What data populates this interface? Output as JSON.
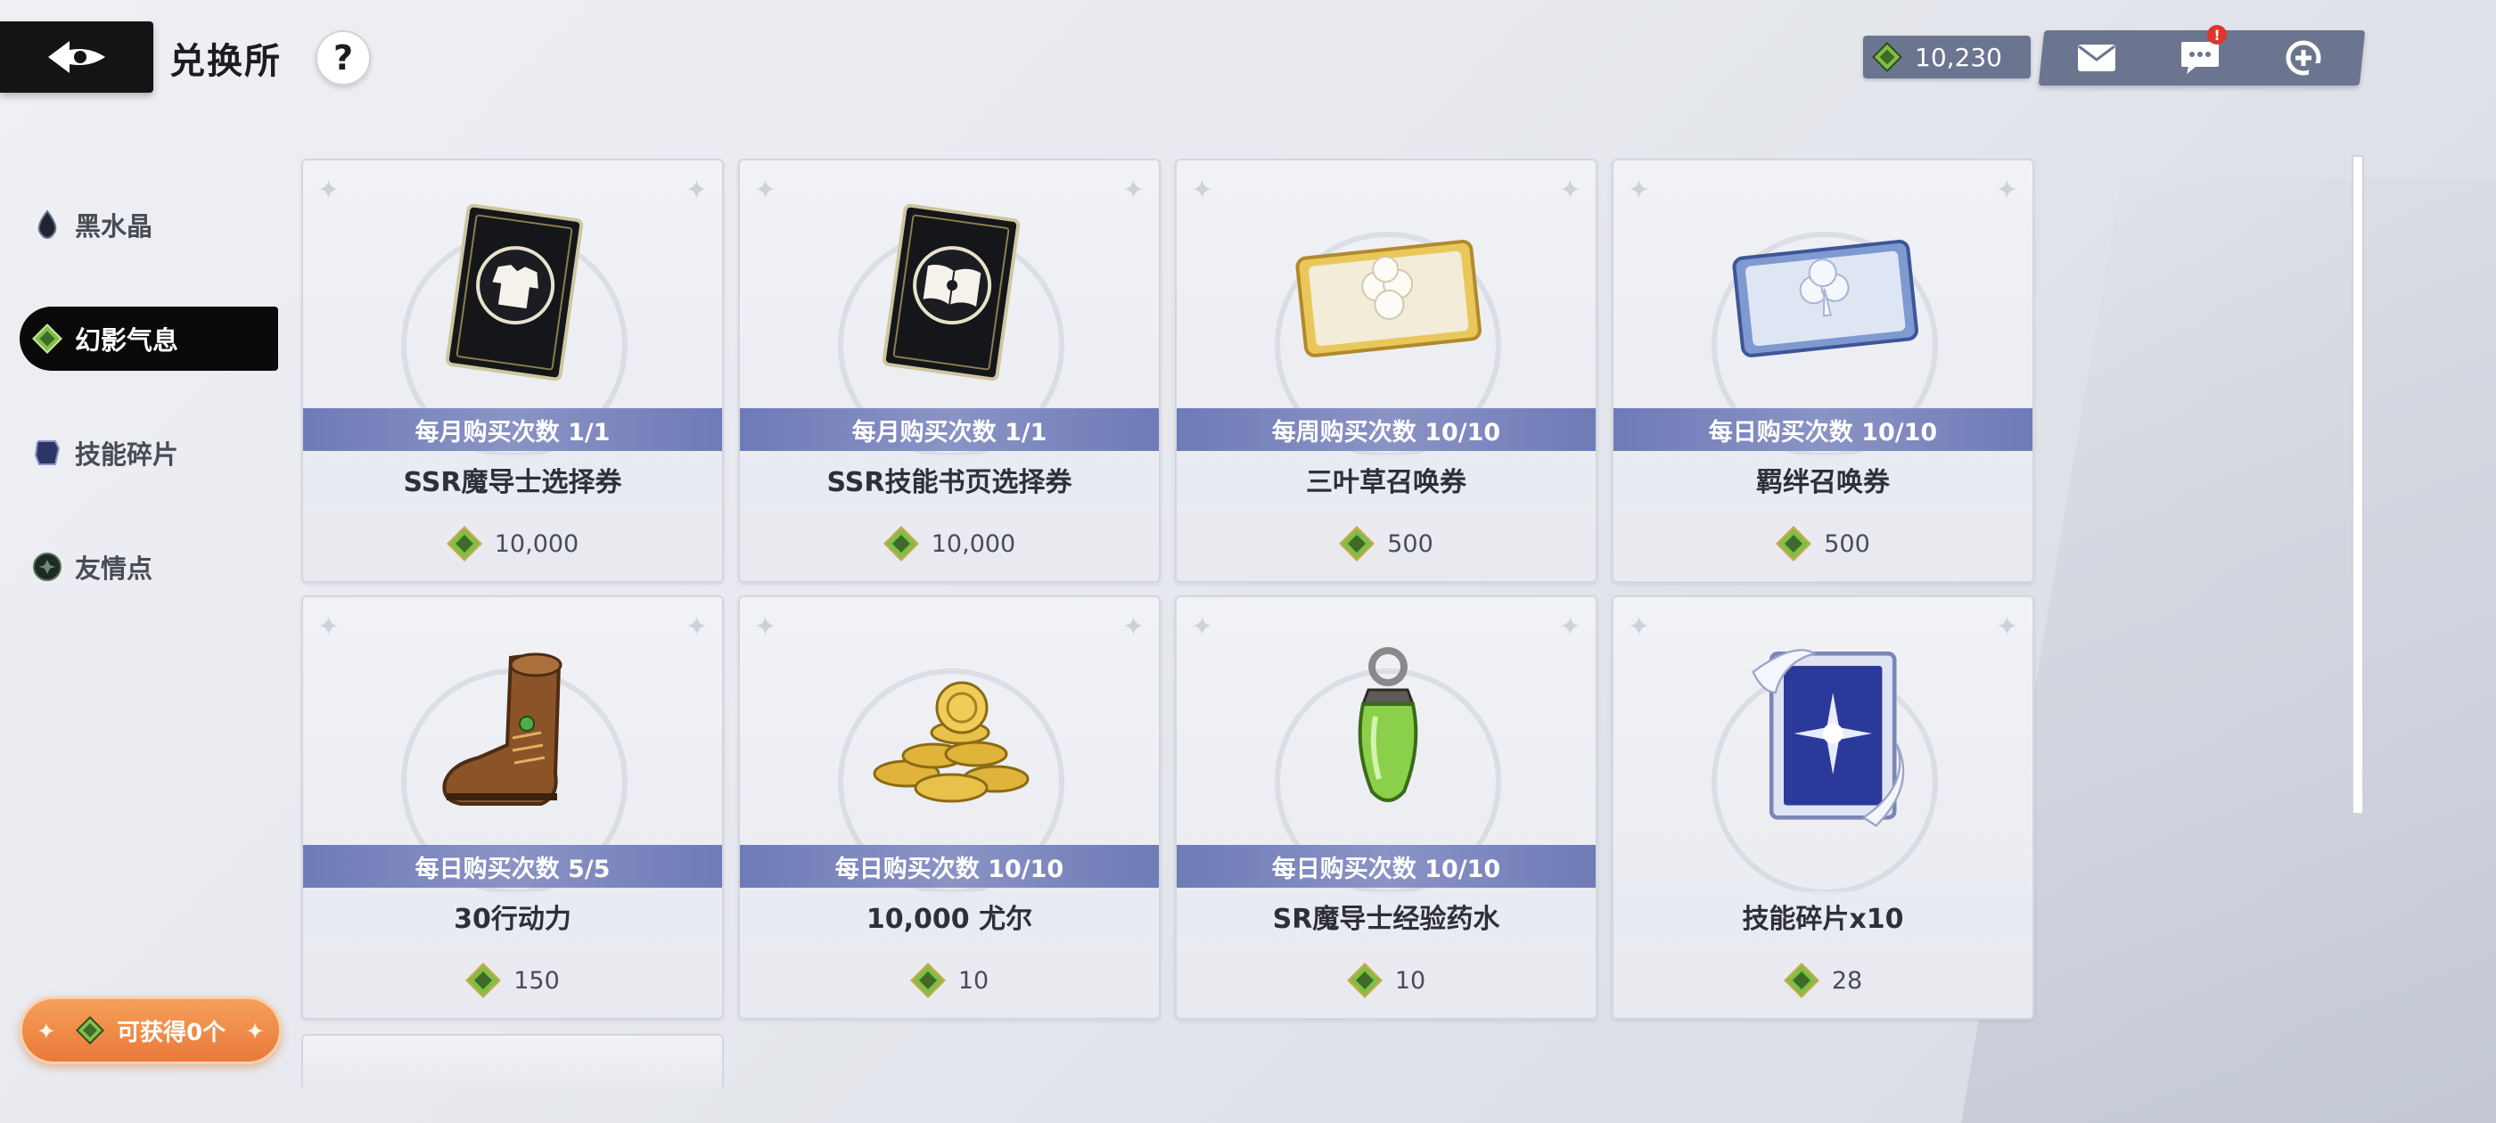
{
  "header": {
    "title": "兑换所",
    "help_label": "?",
    "currency_amount": "10,230",
    "notification_badge": "!"
  },
  "sidebar": {
    "items": [
      {
        "label": "黑水晶",
        "icon": "black-crystal-icon",
        "active": false
      },
      {
        "label": "幻影气息",
        "icon": "phantom-breath-icon",
        "active": true
      },
      {
        "label": "技能碎片",
        "icon": "skill-fragment-icon",
        "active": false
      },
      {
        "label": "友情点",
        "icon": "friendship-point-icon",
        "active": false
      }
    ],
    "obtain_label": "可获得0个"
  },
  "items": [
    {
      "limit": "每月购买次数 1/1",
      "name": "SSR魔导士选择券",
      "price": "10,000",
      "icon": "ssr-mage-ticket-icon"
    },
    {
      "limit": "每月购买次数 1/1",
      "name": "SSR技能书页选择券",
      "price": "10,000",
      "icon": "ssr-skill-page-ticket-icon"
    },
    {
      "limit": "每周购买次数 10/10",
      "name": "三叶草召唤券",
      "price": "500",
      "icon": "clover-summon-ticket-icon"
    },
    {
      "limit": "每日购买次数 10/10",
      "name": "羁绊召唤券",
      "price": "500",
      "icon": "bond-summon-ticket-icon"
    },
    {
      "limit": "每日购买次数 5/5",
      "name": "30行动力",
      "price": "150",
      "icon": "boot-stamina-icon"
    },
    {
      "limit": "每日购买次数 10/10",
      "name": "10,000 尤尔",
      "price": "10",
      "icon": "gold-coins-icon"
    },
    {
      "limit": "每日购买次数 10/10",
      "name": "SR魔导士经验药水",
      "price": "10",
      "icon": "exp-potion-icon"
    },
    {
      "limit": "",
      "name": "技能碎片x10",
      "price": "28",
      "icon": "skill-fragment-card-icon"
    }
  ],
  "colors": {
    "accent_currency": "#6fae3a",
    "limit_banner": "#6e7bb8",
    "obtain_button": "#e9793a"
  }
}
